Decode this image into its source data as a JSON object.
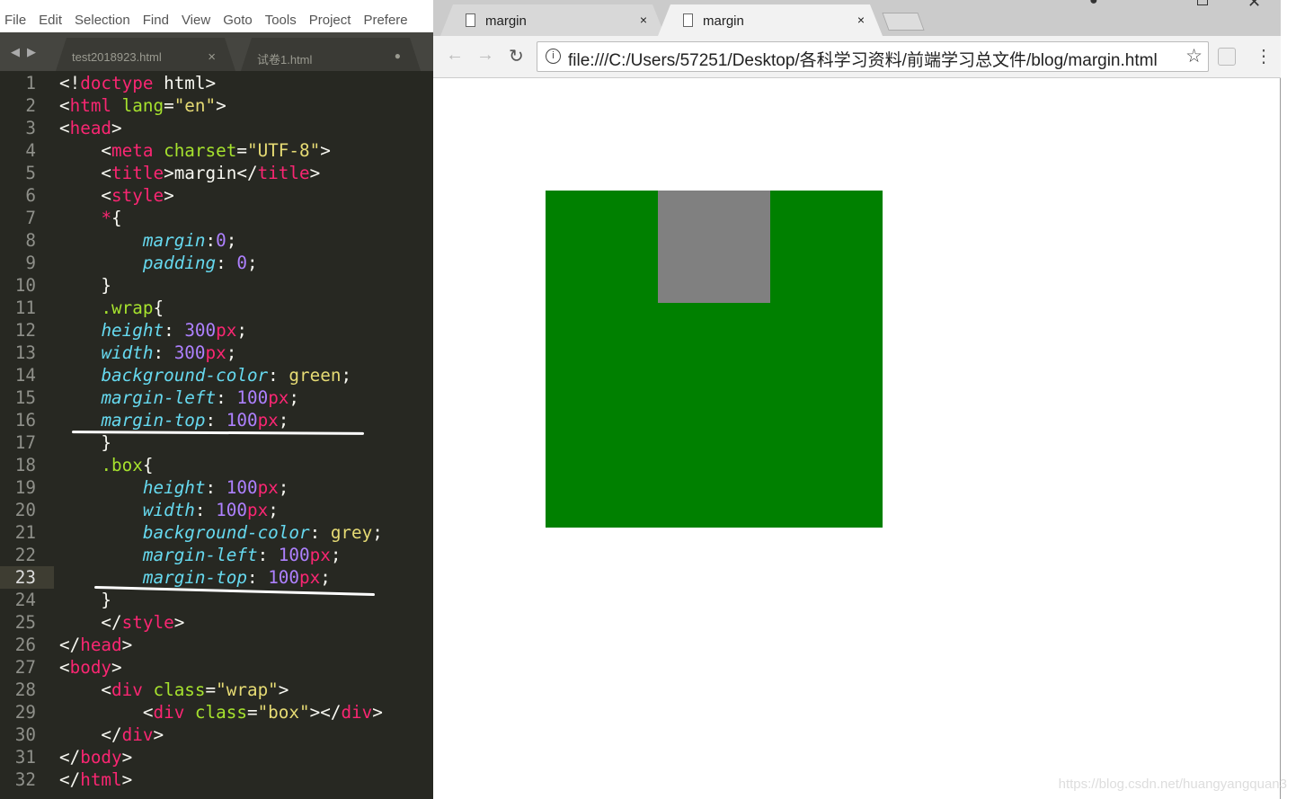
{
  "editor": {
    "menu": [
      "File",
      "Edit",
      "Selection",
      "Find",
      "View",
      "Goto",
      "Tools",
      "Project",
      "Prefere"
    ],
    "tabs": [
      {
        "label": "test2018923.html",
        "status": "×"
      },
      {
        "label": "试卷1.html",
        "status": "●"
      }
    ],
    "highlighted_line": 23,
    "lines": [
      [
        [
          "txt",
          "<!"
        ],
        [
          "tag",
          "doctype"
        ],
        [
          "txt",
          " html>"
        ]
      ],
      [
        [
          "txt",
          "<"
        ],
        [
          "tag",
          "html"
        ],
        [
          "txt",
          " "
        ],
        [
          "attr",
          "lang"
        ],
        [
          "txt",
          "="
        ],
        [
          "str",
          "\"en\""
        ],
        [
          "txt",
          ">"
        ]
      ],
      [
        [
          "txt",
          "<"
        ],
        [
          "tag",
          "head"
        ],
        [
          "txt",
          ">"
        ]
      ],
      [
        [
          "txt",
          "    <"
        ],
        [
          "tag",
          "meta"
        ],
        [
          "txt",
          " "
        ],
        [
          "attr",
          "charset"
        ],
        [
          "txt",
          "="
        ],
        [
          "str",
          "\"UTF-8\""
        ],
        [
          "txt",
          ">"
        ]
      ],
      [
        [
          "txt",
          "    <"
        ],
        [
          "tag",
          "title"
        ],
        [
          "txt",
          ">margin</"
        ],
        [
          "tag",
          "title"
        ],
        [
          "txt",
          ">"
        ]
      ],
      [
        [
          "txt",
          "    <"
        ],
        [
          "tag",
          "style"
        ],
        [
          "txt",
          ">"
        ]
      ],
      [
        [
          "txt",
          "    "
        ],
        [
          "tag",
          "*"
        ],
        [
          "txt",
          "{"
        ]
      ],
      [
        [
          "txt",
          "        "
        ],
        [
          "prop",
          "margin"
        ],
        [
          "txt",
          ":"
        ],
        [
          "num",
          "0"
        ],
        [
          "txt",
          ";"
        ]
      ],
      [
        [
          "txt",
          "        "
        ],
        [
          "prop",
          "padding"
        ],
        [
          "txt",
          ": "
        ],
        [
          "num",
          "0"
        ],
        [
          "txt",
          ";"
        ]
      ],
      [
        [
          "txt",
          "    }"
        ]
      ],
      [
        [
          "txt",
          "    "
        ],
        [
          "sel",
          ".wrap"
        ],
        [
          "txt",
          "{"
        ]
      ],
      [
        [
          "txt",
          "    "
        ],
        [
          "prop",
          "height"
        ],
        [
          "txt",
          ": "
        ],
        [
          "num",
          "300"
        ],
        [
          "tag",
          "px"
        ],
        [
          "txt",
          ";"
        ]
      ],
      [
        [
          "txt",
          "    "
        ],
        [
          "prop",
          "width"
        ],
        [
          "txt",
          ": "
        ],
        [
          "num",
          "300"
        ],
        [
          "tag",
          "px"
        ],
        [
          "txt",
          ";"
        ]
      ],
      [
        [
          "txt",
          "    "
        ],
        [
          "prop",
          "background-color"
        ],
        [
          "txt",
          ": "
        ],
        [
          "str",
          "green"
        ],
        [
          "txt",
          ";"
        ]
      ],
      [
        [
          "txt",
          "    "
        ],
        [
          "prop",
          "margin-left"
        ],
        [
          "txt",
          ": "
        ],
        [
          "num",
          "100"
        ],
        [
          "tag",
          "px"
        ],
        [
          "txt",
          ";"
        ]
      ],
      [
        [
          "txt",
          "    "
        ],
        [
          "prop",
          "margin-top"
        ],
        [
          "txt",
          ": "
        ],
        [
          "num",
          "100"
        ],
        [
          "tag",
          "px"
        ],
        [
          "txt",
          ";"
        ]
      ],
      [
        [
          "txt",
          "    }"
        ]
      ],
      [
        [
          "txt",
          "    "
        ],
        [
          "sel",
          ".box"
        ],
        [
          "txt",
          "{"
        ]
      ],
      [
        [
          "txt",
          "        "
        ],
        [
          "prop",
          "height"
        ],
        [
          "txt",
          ": "
        ],
        [
          "num",
          "100"
        ],
        [
          "tag",
          "px"
        ],
        [
          "txt",
          ";"
        ]
      ],
      [
        [
          "txt",
          "        "
        ],
        [
          "prop",
          "width"
        ],
        [
          "txt",
          ": "
        ],
        [
          "num",
          "100"
        ],
        [
          "tag",
          "px"
        ],
        [
          "txt",
          ";"
        ]
      ],
      [
        [
          "txt",
          "        "
        ],
        [
          "prop",
          "background-color"
        ],
        [
          "txt",
          ": "
        ],
        [
          "str",
          "grey"
        ],
        [
          "txt",
          ";"
        ]
      ],
      [
        [
          "txt",
          "        "
        ],
        [
          "prop",
          "margin-left"
        ],
        [
          "txt",
          ": "
        ],
        [
          "num",
          "100"
        ],
        [
          "tag",
          "px"
        ],
        [
          "txt",
          ";"
        ]
      ],
      [
        [
          "txt",
          "        "
        ],
        [
          "prop",
          "margin-top"
        ],
        [
          "txt",
          ": "
        ],
        [
          "num",
          "100"
        ],
        [
          "tag",
          "px"
        ],
        [
          "txt",
          ";"
        ]
      ],
      [
        [
          "txt",
          "    }"
        ]
      ],
      [
        [
          "txt",
          "    </"
        ],
        [
          "tag",
          "style"
        ],
        [
          "txt",
          ">"
        ]
      ],
      [
        [
          "txt",
          "</"
        ],
        [
          "tag",
          "head"
        ],
        [
          "txt",
          ">"
        ]
      ],
      [
        [
          "txt",
          "<"
        ],
        [
          "tag",
          "body"
        ],
        [
          "txt",
          ">"
        ]
      ],
      [
        [
          "txt",
          "    <"
        ],
        [
          "tag",
          "div"
        ],
        [
          "txt",
          " "
        ],
        [
          "attr",
          "class"
        ],
        [
          "txt",
          "="
        ],
        [
          "str",
          "\"wrap\""
        ],
        [
          "txt",
          ">"
        ]
      ],
      [
        [
          "txt",
          "        <"
        ],
        [
          "tag",
          "div"
        ],
        [
          "txt",
          " "
        ],
        [
          "attr",
          "class"
        ],
        [
          "txt",
          "="
        ],
        [
          "str",
          "\"box\""
        ],
        [
          "txt",
          "></"
        ],
        [
          "tag",
          "div"
        ],
        [
          "txt",
          ">"
        ]
      ],
      [
        [
          "txt",
          "    </"
        ],
        [
          "tag",
          "div"
        ],
        [
          "txt",
          ">"
        ]
      ],
      [
        [
          "txt",
          "</"
        ],
        [
          "tag",
          "body"
        ],
        [
          "txt",
          ">"
        ]
      ],
      [
        [
          "txt",
          "</"
        ],
        [
          "tag",
          "html"
        ],
        [
          "txt",
          ">"
        ]
      ]
    ]
  },
  "browser": {
    "tabs": [
      {
        "title": "margin",
        "close": "×"
      },
      {
        "title": "margin",
        "close": "×"
      }
    ],
    "url": "file:///C:/Users/57251/Desktop/各科学习资料/前端学习总文件/blog/margin.html",
    "page": {
      "wrap_color": "#008000",
      "box_color": "#808080"
    }
  },
  "watermark": "https://blog.csdn.net/huangyangquan3"
}
